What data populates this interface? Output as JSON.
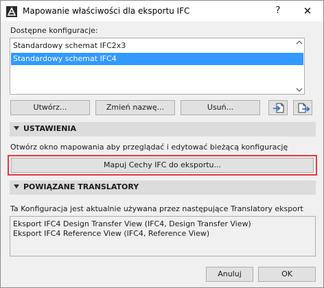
{
  "window": {
    "title": "Mapowanie właściwości dla eksportu IFC",
    "help_label": "?",
    "close_label": "✕"
  },
  "configs": {
    "label": "Dostępne konfiguracje:",
    "items": [
      {
        "label": "Standardowy schemat IFC2x3",
        "selected": false
      },
      {
        "label": "Standardowy schemat IFC4",
        "selected": true
      }
    ]
  },
  "actions": {
    "create": "Utwórz...",
    "rename": "Zmień nazwę...",
    "delete": "Usuń...",
    "import_icon": "import-icon",
    "export_icon": "export-icon"
  },
  "settings": {
    "header": "USTAWIENIA",
    "description": "Otwórz okno mapowania aby przeglądać i edytować bieżącą konfigurację",
    "map_button": "Mapuj Cechy IFC do eksportu..."
  },
  "translators": {
    "header": "POWIĄZANE TRANSLATORY",
    "description": "Ta Konfiguracja jest aktualnie używana przez następujące Translatory eksport",
    "lines": [
      "Eksport IFC4 Design Transfer View (IFC4, Design Transfer View)",
      "Eksport IFC4 Reference View (IFC4, Reference View)"
    ]
  },
  "footer": {
    "cancel": "Anuluj",
    "ok": "OK"
  },
  "colors": {
    "selection": "#3399ff",
    "highlight_frame": "#e53935",
    "section_bg": "#dcdcdc"
  }
}
